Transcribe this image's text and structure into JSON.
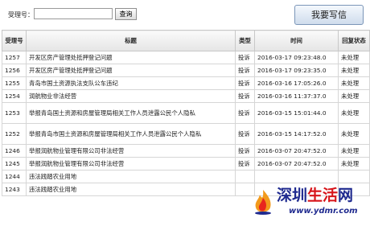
{
  "search": {
    "label": "受理号：",
    "button": "查询",
    "value": ""
  },
  "write_button": "我要写信",
  "table": {
    "headers": [
      "受理号",
      "标题",
      "类型",
      "时间",
      "回复状态"
    ],
    "rows": [
      {
        "id": "1257",
        "title": "开发区房产管理处抵押登记问题",
        "type": "投诉",
        "time": "2016-03-17 09:23:48.0",
        "status": "未处理"
      },
      {
        "id": "1256",
        "title": "开发区房产管理处抵押登记问题",
        "type": "投诉",
        "time": "2016-03-17 09:23:35.0",
        "status": "未处理"
      },
      {
        "id": "1255",
        "title": "青岛市国土资源执法支队公车违纪",
        "type": "投诉",
        "time": "2016-03-16 17:05:26.0",
        "status": "未处理"
      },
      {
        "id": "1254",
        "title": "润航物业非法经营",
        "type": "投诉",
        "time": "2016-03-16 11:37:37.0",
        "status": "未处理"
      },
      {
        "id": "1253",
        "title": "举报青岛国土资源和房屋管理局相关工作人员泄露公民个人隐私",
        "type": "投诉",
        "time": "2016-03-15 15:01:44.0",
        "status": "未处理"
      },
      {
        "id": "1252",
        "title": "举报青岛市国土资源和房屋管理局相关工作人员泄露公民个人隐私",
        "type": "投诉",
        "time": "2016-03-15 14:17:52.0",
        "status": "未处理"
      },
      {
        "id": "1246",
        "title": "举报润航物业管理有限公司非法经营",
        "type": "投诉",
        "time": "2016-03-07 20:47:52.0",
        "status": "未处理"
      },
      {
        "id": "1245",
        "title": "举报润航物业管理有限公司非法经营",
        "type": "投诉",
        "time": "2016-03-07 20:47:52.0",
        "status": "未处理"
      },
      {
        "id": "1244",
        "title": "违法践踏农业用地",
        "type": "",
        "time": "",
        "status": ""
      },
      {
        "id": "1243",
        "title": "违法践踏农业用地",
        "type": "",
        "time": "",
        "status": ""
      }
    ]
  },
  "watermark": {
    "brand_a": "深圳",
    "brand_b": "生活",
    "brand_c": "网",
    "url": "www.ydmr.com"
  }
}
